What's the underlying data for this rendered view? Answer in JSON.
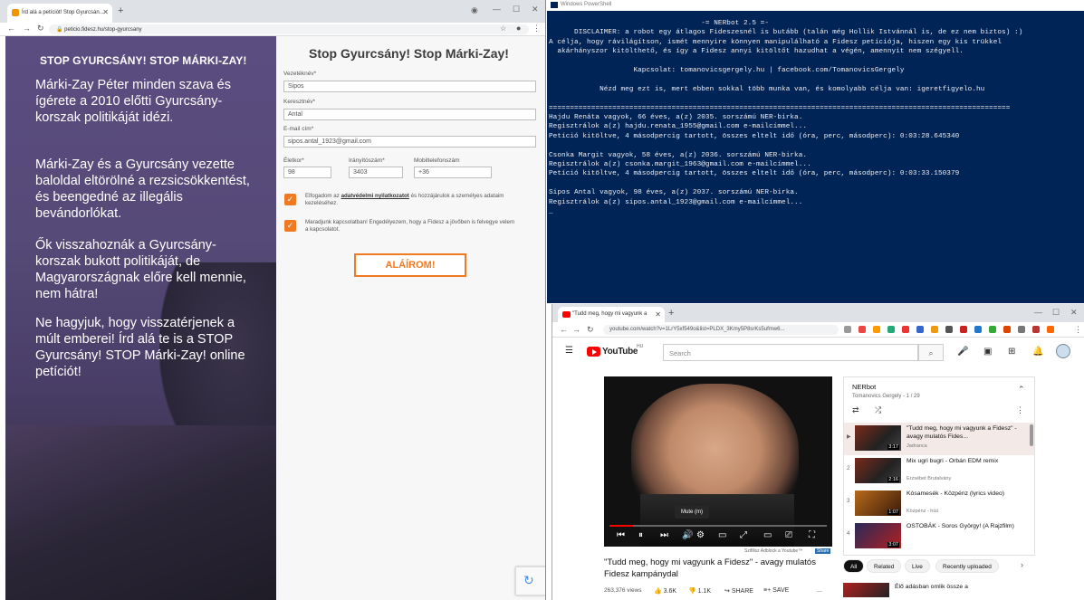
{
  "left_browser": {
    "tab_title": "Írd alá a petíciót! Stop Gyurcsán...",
    "url": "peticio.fidesz.hu/stop-gyurcsany",
    "new_tab": "+",
    "heading": "STOP GYURCSÁNY! STOP MÁRKI-ZAY!",
    "paragraphs": [
      "Márki-Zay Péter minden szava és ígérete a 2010 előtti Gyurcsány-korszak politikáját idézi.",
      "Márki-Zay és a Gyurcsány vezette baloldal eltörölné a rezsicsökkentést, és beengedné az illegális bevándorlókat.",
      "Ők visszahoznák a Gyurcsány-korszak bukott politikáját, de Magyarországnak előre kell mennie, nem hátra!",
      "Ne hagyjuk, hogy visszatérjenek a múlt emberei! Írd alá te is a STOP Gyurcsány! STOP Márki-Zay! online petíciót!"
    ],
    "form": {
      "title": "Stop Gyurcsány! Stop Márki-Zay!",
      "lastname_label": "Vezetéknév*",
      "lastname_value": "Sipos",
      "firstname_label": "Keresztnév*",
      "firstname_value": "Antal",
      "email_label": "E-mail cím*",
      "email_value": "sipos.antal_1923@gmail.com",
      "age_label": "Életkor*",
      "age_value": "98",
      "zip_label": "Irányítószám*",
      "zip_value": "3403",
      "phone_label": "Mobiltelefonszám",
      "phone_value": "+36",
      "consent1_pre": "Elfogadom az ",
      "consent1_link": "adatvédelmi nyilatkozatot",
      "consent1_post": " és hozzájárulok a személyes adataim kezeléséhez.",
      "consent2": "Maradjunk kapcsolatban! Engedélyezem, hogy a Fidesz a jövőben is felvegye velem a kapcsolatot.",
      "submit_label": "ALÁÍROM!"
    }
  },
  "powershell": {
    "title": "Windows PowerShell",
    "lines": [
      "                                    -= NERbot 2.5 =-",
      "      DISCLAIMER: a robot egy átlagos Fideszesnél is butább (talán még Hollik Istvánnál is, de ez nem biztos) :)",
      "A célja, hogy rávilágítson, ismét mennyire könnyen manipulálható a Fidesz petíciója, hiszen egy kis trükkel",
      "  akárhányszor kitölthető, és így a Fidesz annyi kitöltőt hazudhat a végén, amennyit nem szégyell.",
      "",
      "                    Kapcsolat: tomanovicsgergely.hu | facebook.com/TomanovicsGergely",
      "",
      "            Nézd meg ezt is, mert ebben sokkal több munka van, és komolyabb célja van: igeretfigyelo.hu",
      "",
      "=============================================================================================================",
      "Hajdu Renáta vagyok, 66 éves, a(z) 2035. sorszámú NER-birka.",
      "Regisztrálok a(z) hajdu.renata_1955@gmail.com e-mailcímmel...",
      "Petíció kitöltve, 4 másodpercig tartott, összes eltelt idő (óra, perc, másodperc): 0:03:28.645340",
      "",
      "Csonka Margit vagyok, 58 éves, a(z) 2036. sorszámú NER-birka.",
      "Regisztrálok a(z) csonka.margit_1963@gmail.com e-mailcímmel...",
      "Petíció kitöltve, 4 másodpercig tartott, összes eltelt idő (óra, perc, másodperc): 0:03:33.150379",
      "",
      "Sipos Antal vagyok, 98 éves, a(z) 2037. sorszámú NER-birka.",
      "Regisztrálok a(z) sipos.antal_1923@gmail.com e-mailcímmel...",
      "_"
    ]
  },
  "right_browser": {
    "tab_title": "\"Tudd meg, hogy mi vagyunk a",
    "url": "youtube.com/watch?v=1LrY5xf549o&list=PLDX_3Kmy5P8srKs5ufmw6...",
    "search_placeholder": "Search",
    "logo_text": "YouTube",
    "logo_region": "HU",
    "mute_tooltip": "Mute (m)",
    "video_title": "\"Tudd meg, hogy mi vagyunk a Fidesz\" - avagy mulatós Fidesz kampánydal",
    "adblock_note": "Szifilisz Adblock a Youtube™",
    "share_badge": "Share",
    "views": "263,376 views",
    "likes": "3.6K",
    "dislikes": "1.1K",
    "share": "SHARE",
    "save": "SAVE",
    "more": "...",
    "playlist": {
      "title": "NERbot",
      "subtitle": "Tomanovics Gergely - 1 / 29",
      "items": [
        {
          "num": "▶",
          "name": "\"Tudd meg, hogy mi vagyunk a Fidesz\" - avagy mulatós Fides...",
          "chan": "Jadranca",
          "dur": "3:17"
        },
        {
          "num": "2",
          "name": "Mix ugri bugri - Orbán EDM remix",
          "chan": "Erzsébet Brutalvány",
          "dur": "2:16"
        },
        {
          "num": "3",
          "name": "Kósamesék - Közpénz (lyrics video)",
          "chan": "Közpénz - hüü",
          "dur": "1:07"
        },
        {
          "num": "4",
          "name": "OSTOBÁK - Soros György! (A Rajzfilm)",
          "chan": "",
          "dur": "3:07"
        }
      ]
    },
    "chips": [
      "All",
      "Related",
      "Live",
      "Recently uploaded"
    ],
    "next_title": "Élő adásban omlik össze a"
  }
}
